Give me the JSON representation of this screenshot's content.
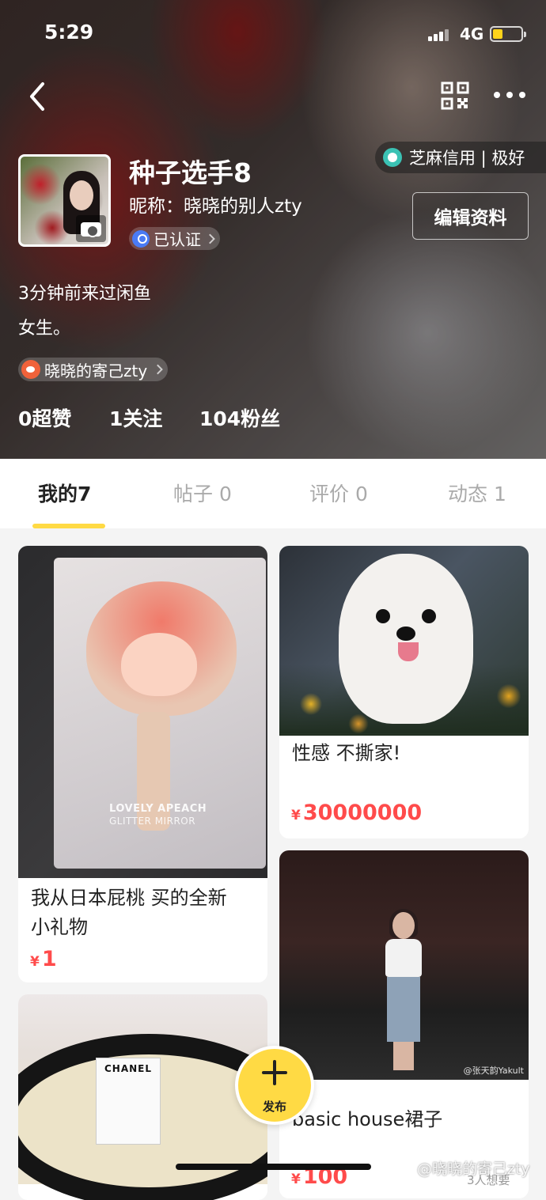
{
  "status_bar": {
    "time": "5:29",
    "network": "4G"
  },
  "profile": {
    "name": "种子选手8",
    "nickname": "昵称：晓晓的别人zty",
    "verified": "已认证",
    "credit": "芝麻信用 | 极好",
    "edit_label": "编辑资料",
    "last_seen": "3分钟前来过闲鱼",
    "bio": "女生。",
    "weibo": "晓晓的寄己zty",
    "stats": {
      "likes": "0超赞",
      "following": "1关注",
      "fans": "104粉丝"
    }
  },
  "tabs": [
    "我的7",
    "帖子 0",
    "评价 0",
    "动态 1"
  ],
  "items": [
    {
      "title_line1": "我从日本屁桃 买的全新",
      "title_line2": "小礼物",
      "currency": "¥",
      "price": "1",
      "image_text": [
        "LOVELY APEACH",
        "GLITTER MIRROR"
      ]
    },
    {
      "title": "性感 不撕家!",
      "currency": "¥",
      "price": "30000000"
    },
    {
      "title": "basic house裙子",
      "currency": "¥",
      "price": "100",
      "image_credit": "@张天韵Yakult",
      "wants": "3人想要"
    },
    {
      "image_text": "CHANEL"
    }
  ],
  "publish_label": "发布",
  "watermark": "@晓晓的寄己zty",
  "colors": {
    "accent": "#ffda44",
    "price": "#ff4b4b"
  }
}
